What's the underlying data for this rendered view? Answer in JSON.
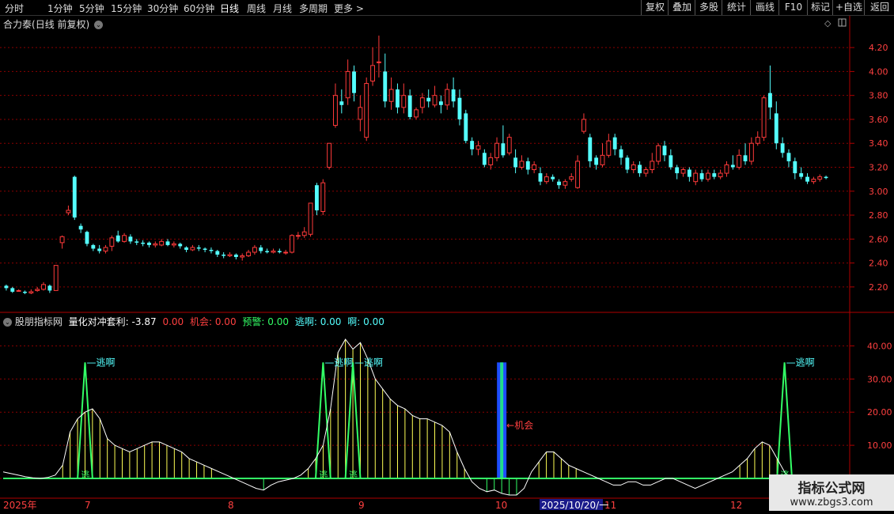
{
  "toolbar": {
    "periods": [
      "分时",
      "1分钟",
      "5分钟",
      "15分钟",
      "30分钟",
      "60分钟",
      "日线",
      "周线",
      "月线",
      "多周期",
      "更多 >"
    ],
    "active_period": "日线",
    "right_buttons": [
      "复权",
      "叠加",
      "多股",
      "统计",
      "画线",
      "F10",
      "标记",
      "+自选",
      "返回"
    ]
  },
  "chart_title": {
    "name": "合力泰",
    "mode": "(日线 前复权)"
  },
  "indicator": {
    "name": "股朋指标网",
    "label": "量化对冲套利:",
    "value": "-3.87",
    "v2": "0.00",
    "chance_label": "机会:",
    "chance_value": "0.00",
    "warn_label": "预警:",
    "warn_value": "0.00",
    "escape_label": "逃啊:",
    "escape_value": "0.00",
    "ah_label": "啊:",
    "ah_value": "0.00"
  },
  "annotations": {
    "escape": "逃啊",
    "chance": "机会",
    "escape_short": "逃"
  },
  "axis": {
    "year_label": "2025年",
    "months": [
      "7",
      "8",
      "9",
      "10",
      "11",
      "12"
    ],
    "cursor_date": "2025/10/20/一"
  },
  "watermark": {
    "line1": "指标公式网",
    "line2": "www.zbgs3.com"
  },
  "colors": {
    "up": "#ff3a3a",
    "down": "#54ffff",
    "grid": "#8b0000",
    "green": "#33ff66",
    "white": "#ffffff",
    "yellow": "#ffff55",
    "blue": "#1e4dff"
  },
  "chart_data": [
    {
      "type": "candlestick",
      "price_ticks": [
        2.2,
        2.4,
        2.6,
        2.8,
        3.0,
        3.2,
        3.4,
        3.6,
        3.8,
        4.0,
        4.2
      ],
      "ylim": [
        2.1,
        4.3
      ],
      "candles": [
        [
          2.21,
          2.19,
          2.22,
          2.17
        ],
        [
          2.19,
          2.16,
          2.2,
          2.15
        ],
        [
          2.17,
          2.17,
          2.18,
          2.16
        ],
        [
          2.16,
          2.15,
          2.17,
          2.14
        ],
        [
          2.15,
          2.16,
          2.18,
          2.14
        ],
        [
          2.17,
          2.18,
          2.2,
          2.16
        ],
        [
          2.18,
          2.22,
          2.24,
          2.17
        ],
        [
          2.21,
          2.17,
          2.22,
          2.15
        ],
        [
          2.17,
          2.38,
          2.38,
          2.17
        ],
        [
          2.57,
          2.62,
          2.63,
          2.52
        ],
        [
          2.82,
          2.84,
          2.88,
          2.8
        ],
        [
          3.12,
          2.78,
          3.13,
          2.76
        ],
        [
          2.71,
          2.68,
          2.73,
          2.65
        ],
        [
          2.66,
          2.56,
          2.67,
          2.54
        ],
        [
          2.55,
          2.52,
          2.56,
          2.5
        ],
        [
          2.52,
          2.5,
          2.55,
          2.48
        ],
        [
          2.5,
          2.53,
          2.55,
          2.48
        ],
        [
          2.54,
          2.61,
          2.63,
          2.5
        ],
        [
          2.63,
          2.58,
          2.67,
          2.57
        ],
        [
          2.58,
          2.63,
          2.65,
          2.57
        ],
        [
          2.62,
          2.58,
          2.64,
          2.56
        ],
        [
          2.58,
          2.57,
          2.6,
          2.55
        ],
        [
          2.57,
          2.56,
          2.59,
          2.54
        ],
        [
          2.57,
          2.55,
          2.58,
          2.53
        ],
        [
          2.55,
          2.56,
          2.58,
          2.53
        ],
        [
          2.55,
          2.58,
          2.6,
          2.54
        ],
        [
          2.58,
          2.55,
          2.6,
          2.54
        ],
        [
          2.55,
          2.56,
          2.58,
          2.53
        ],
        [
          2.56,
          2.54,
          2.57,
          2.52
        ],
        [
          2.53,
          2.51,
          2.54,
          2.49
        ],
        [
          2.51,
          2.53,
          2.55,
          2.5
        ],
        [
          2.53,
          2.52,
          2.55,
          2.5
        ],
        [
          2.52,
          2.51,
          2.53,
          2.49
        ],
        [
          2.51,
          2.5,
          2.53,
          2.48
        ],
        [
          2.5,
          2.47,
          2.51,
          2.45
        ],
        [
          2.47,
          2.46,
          2.49,
          2.44
        ],
        [
          2.46,
          2.47,
          2.49,
          2.45
        ],
        [
          2.47,
          2.45,
          2.48,
          2.43
        ],
        [
          2.45,
          2.46,
          2.48,
          2.42
        ],
        [
          2.46,
          2.49,
          2.51,
          2.45
        ],
        [
          2.49,
          2.53,
          2.55,
          2.47
        ],
        [
          2.53,
          2.5,
          2.55,
          2.48
        ],
        [
          2.5,
          2.49,
          2.52,
          2.48
        ],
        [
          2.49,
          2.5,
          2.52,
          2.48
        ],
        [
          2.5,
          2.49,
          2.52,
          2.48
        ],
        [
          2.49,
          2.49,
          2.51,
          2.47
        ],
        [
          2.49,
          2.63,
          2.64,
          2.48
        ],
        [
          2.63,
          2.63,
          2.66,
          2.6
        ],
        [
          2.63,
          2.66,
          2.7,
          2.61
        ],
        [
          2.64,
          2.9,
          2.9,
          2.62
        ],
        [
          3.05,
          2.84,
          3.07,
          2.8
        ],
        [
          2.83,
          3.07,
          3.1,
          2.8
        ],
        [
          3.2,
          3.4,
          3.4,
          3.18
        ],
        [
          3.55,
          3.8,
          3.9,
          3.53
        ],
        [
          3.75,
          3.72,
          3.85,
          3.65
        ],
        [
          3.78,
          4.0,
          4.1,
          3.72
        ],
        [
          4.0,
          3.82,
          4.05,
          3.75
        ],
        [
          3.6,
          3.7,
          3.8,
          3.5
        ],
        [
          3.45,
          3.9,
          3.95,
          3.42
        ],
        [
          3.92,
          4.05,
          4.2,
          3.88
        ],
        [
          4.08,
          4.08,
          4.3,
          3.95
        ],
        [
          4.0,
          3.75,
          4.15,
          3.7
        ],
        [
          3.75,
          3.85,
          3.95,
          3.68
        ],
        [
          3.85,
          3.7,
          3.9,
          3.65
        ],
        [
          3.7,
          3.8,
          3.9,
          3.65
        ],
        [
          3.8,
          3.62,
          3.85,
          3.6
        ],
        [
          3.62,
          3.68,
          3.7,
          3.6
        ],
        [
          3.7,
          3.78,
          3.82,
          3.65
        ],
        [
          3.78,
          3.75,
          3.85,
          3.7
        ],
        [
          3.72,
          3.8,
          3.88,
          3.7
        ],
        [
          3.75,
          3.72,
          3.8,
          3.65
        ],
        [
          3.72,
          3.85,
          3.9,
          3.68
        ],
        [
          3.85,
          3.75,
          3.95,
          3.7
        ],
        [
          3.78,
          3.6,
          3.85,
          3.55
        ],
        [
          3.65,
          3.42,
          3.68,
          3.4
        ],
        [
          3.42,
          3.35,
          3.45,
          3.3
        ],
        [
          3.35,
          3.38,
          3.42,
          3.3
        ],
        [
          3.32,
          3.22,
          3.35,
          3.2
        ],
        [
          3.22,
          3.28,
          3.32,
          3.18
        ],
        [
          3.28,
          3.4,
          3.45,
          3.25
        ],
        [
          3.4,
          3.3,
          3.55,
          3.28
        ],
        [
          3.32,
          3.45,
          3.48,
          3.3
        ],
        [
          3.28,
          3.2,
          3.35,
          3.15
        ],
        [
          3.2,
          3.25,
          3.3,
          3.18
        ],
        [
          3.25,
          3.18,
          3.28,
          3.14
        ],
        [
          3.18,
          3.22,
          3.25,
          3.15
        ],
        [
          3.15,
          3.08,
          3.2,
          3.05
        ],
        [
          3.08,
          3.12,
          3.15,
          3.06
        ],
        [
          3.12,
          3.1,
          3.14,
          3.08
        ],
        [
          3.08,
          3.05,
          3.1,
          3.02
        ],
        [
          3.05,
          3.08,
          3.1,
          3.02
        ],
        [
          3.1,
          3.12,
          3.15,
          3.08
        ],
        [
          3.03,
          3.25,
          3.3,
          3.02
        ],
        [
          3.5,
          3.6,
          3.65,
          3.48
        ],
        [
          3.45,
          3.25,
          3.48,
          3.2
        ],
        [
          3.28,
          3.22,
          3.3,
          3.18
        ],
        [
          3.22,
          3.3,
          3.4,
          3.2
        ],
        [
          3.3,
          3.42,
          3.48,
          3.28
        ],
        [
          3.45,
          3.35,
          3.48,
          3.3
        ],
        [
          3.35,
          3.28,
          3.38,
          3.22
        ],
        [
          3.28,
          3.18,
          3.3,
          3.15
        ],
        [
          3.18,
          3.22,
          3.25,
          3.15
        ],
        [
          3.22,
          3.15,
          3.25,
          3.12
        ],
        [
          3.15,
          3.18,
          3.2,
          3.12
        ],
        [
          3.18,
          3.25,
          3.32,
          3.15
        ],
        [
          3.25,
          3.38,
          3.4,
          3.22
        ],
        [
          3.38,
          3.3,
          3.42,
          3.25
        ],
        [
          3.3,
          3.2,
          3.35,
          3.18
        ],
        [
          3.2,
          3.15,
          3.22,
          3.1
        ],
        [
          3.15,
          3.18,
          3.2,
          3.12
        ],
        [
          3.18,
          3.12,
          3.2,
          3.08
        ],
        [
          3.08,
          3.15,
          3.18,
          3.05
        ],
        [
          3.15,
          3.1,
          3.18,
          3.08
        ],
        [
          3.1,
          3.15,
          3.18,
          3.08
        ],
        [
          3.15,
          3.12,
          3.18,
          3.1
        ],
        [
          3.12,
          3.15,
          3.18,
          3.1
        ],
        [
          3.15,
          3.22,
          3.25,
          3.12
        ],
        [
          3.22,
          3.2,
          3.3,
          3.18
        ],
        [
          3.2,
          3.3,
          3.35,
          3.18
        ],
        [
          3.3,
          3.25,
          3.4,
          3.22
        ],
        [
          3.25,
          3.4,
          3.45,
          3.22
        ],
        [
          3.4,
          3.45,
          3.5,
          3.38
        ],
        [
          3.45,
          3.78,
          3.8,
          3.42
        ],
        [
          3.82,
          3.7,
          4.05,
          3.6
        ],
        [
          3.65,
          3.4,
          3.75,
          3.35
        ],
        [
          3.4,
          3.32,
          3.45,
          3.28
        ],
        [
          3.32,
          3.25,
          3.35,
          3.2
        ],
        [
          3.25,
          3.15,
          3.28,
          3.1
        ],
        [
          3.15,
          3.12,
          3.2,
          3.1
        ],
        [
          3.12,
          3.08,
          3.15,
          3.06
        ],
        [
          3.08,
          3.1,
          3.12,
          3.06
        ],
        [
          3.1,
          3.12,
          3.14,
          3.08
        ],
        [
          3.12,
          3.11,
          3.13,
          3.1
        ]
      ]
    },
    {
      "type": "line",
      "ylim": [
        -5,
        47
      ],
      "y_ticks": [
        0.0,
        10.0,
        20.0,
        30.0,
        40.0
      ],
      "series": [
        {
          "key": "white",
          "values": [
            2,
            1.5,
            1,
            0.5,
            0.2,
            0,
            0.3,
            1,
            4,
            14,
            18,
            20,
            21,
            18,
            12,
            10,
            9,
            8,
            9,
            10,
            11,
            11,
            10,
            9,
            8,
            6,
            5,
            4,
            3,
            2,
            1,
            0,
            -1,
            -2,
            -3,
            -3.5,
            -2,
            -1,
            -0.5,
            0,
            1,
            3,
            6,
            10,
            21,
            38,
            42,
            39,
            41,
            36,
            30,
            27,
            24,
            22,
            21,
            19,
            18,
            18,
            17,
            16,
            14,
            8,
            3,
            -1,
            -3,
            -4,
            -3.5,
            -4.5,
            -5,
            -5,
            -3,
            2,
            5,
            8,
            8,
            6,
            4,
            3,
            2,
            1,
            0,
            -1,
            -2,
            -2,
            -1,
            -1,
            -2,
            -2,
            -1,
            0,
            0,
            -1,
            -2,
            -3,
            -2,
            -1,
            0,
            1,
            2,
            4,
            6,
            9,
            11,
            10,
            6,
            2,
            -1,
            -3,
            -4,
            -4,
            -3.5,
            -3.5
          ]
        },
        {
          "key": "green",
          "values": [
            0,
            0,
            0,
            0,
            0,
            0,
            0,
            0,
            0,
            0,
            0,
            35,
            0,
            0,
            0,
            0,
            0,
            0,
            0,
            0,
            0,
            0,
            0,
            0,
            0,
            0,
            0,
            0,
            0,
            0,
            0,
            0,
            0,
            0,
            0,
            0,
            0,
            0,
            0,
            0,
            0,
            0,
            0,
            35,
            0,
            0,
            0,
            35,
            0,
            0,
            0,
            0,
            0,
            0,
            0,
            0,
            0,
            0,
            0,
            0,
            0,
            0,
            0,
            0,
            0,
            0,
            0,
            0,
            0,
            0,
            0,
            0,
            0,
            0,
            0,
            0,
            0,
            0,
            0,
            0,
            0,
            0,
            0,
            0,
            0,
            0,
            0,
            0,
            0,
            0,
            0,
            0,
            0,
            0,
            0,
            0,
            0,
            0,
            0,
            0,
            0,
            0,
            0,
            0,
            0,
            35,
            0,
            0,
            0,
            0,
            0,
            0,
            0
          ]
        }
      ]
    }
  ]
}
